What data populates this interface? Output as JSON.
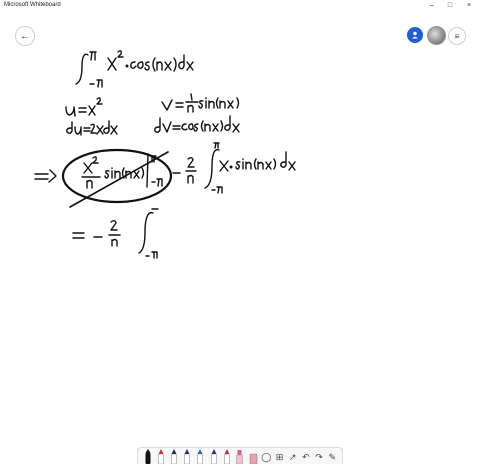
{
  "window": {
    "title": "Microsoft Whiteboard",
    "minimize": "–",
    "maximize": "□",
    "close": "×"
  },
  "header": {
    "back_icon": "←",
    "user_icon": "person-icon",
    "menu_icon": "≡"
  },
  "toolbar": {
    "tools": [
      {
        "name": "pen-black",
        "color": "#111111"
      },
      {
        "name": "pen-red",
        "color": "#d32f2f"
      },
      {
        "name": "pen-dark-blue",
        "color": "#1a2b6d"
      },
      {
        "name": "pen-navy",
        "color": "#2b2f6b"
      },
      {
        "name": "pen-teal",
        "color": "#1a6fa0"
      },
      {
        "name": "pen-violet",
        "color": "#3d2b7a"
      },
      {
        "name": "pen-magenta",
        "color": "#b02a68"
      },
      {
        "name": "highlighter",
        "color": "#e05a8a"
      },
      {
        "name": "eraser",
        "color": "#e8a0b0"
      }
    ],
    "lasso_icon": "◯",
    "add_icon": "⊞",
    "shape_icon": "↗",
    "undo_icon": "↶",
    "redo_icon": "↷",
    "pen_settings_icon": "✎"
  }
}
